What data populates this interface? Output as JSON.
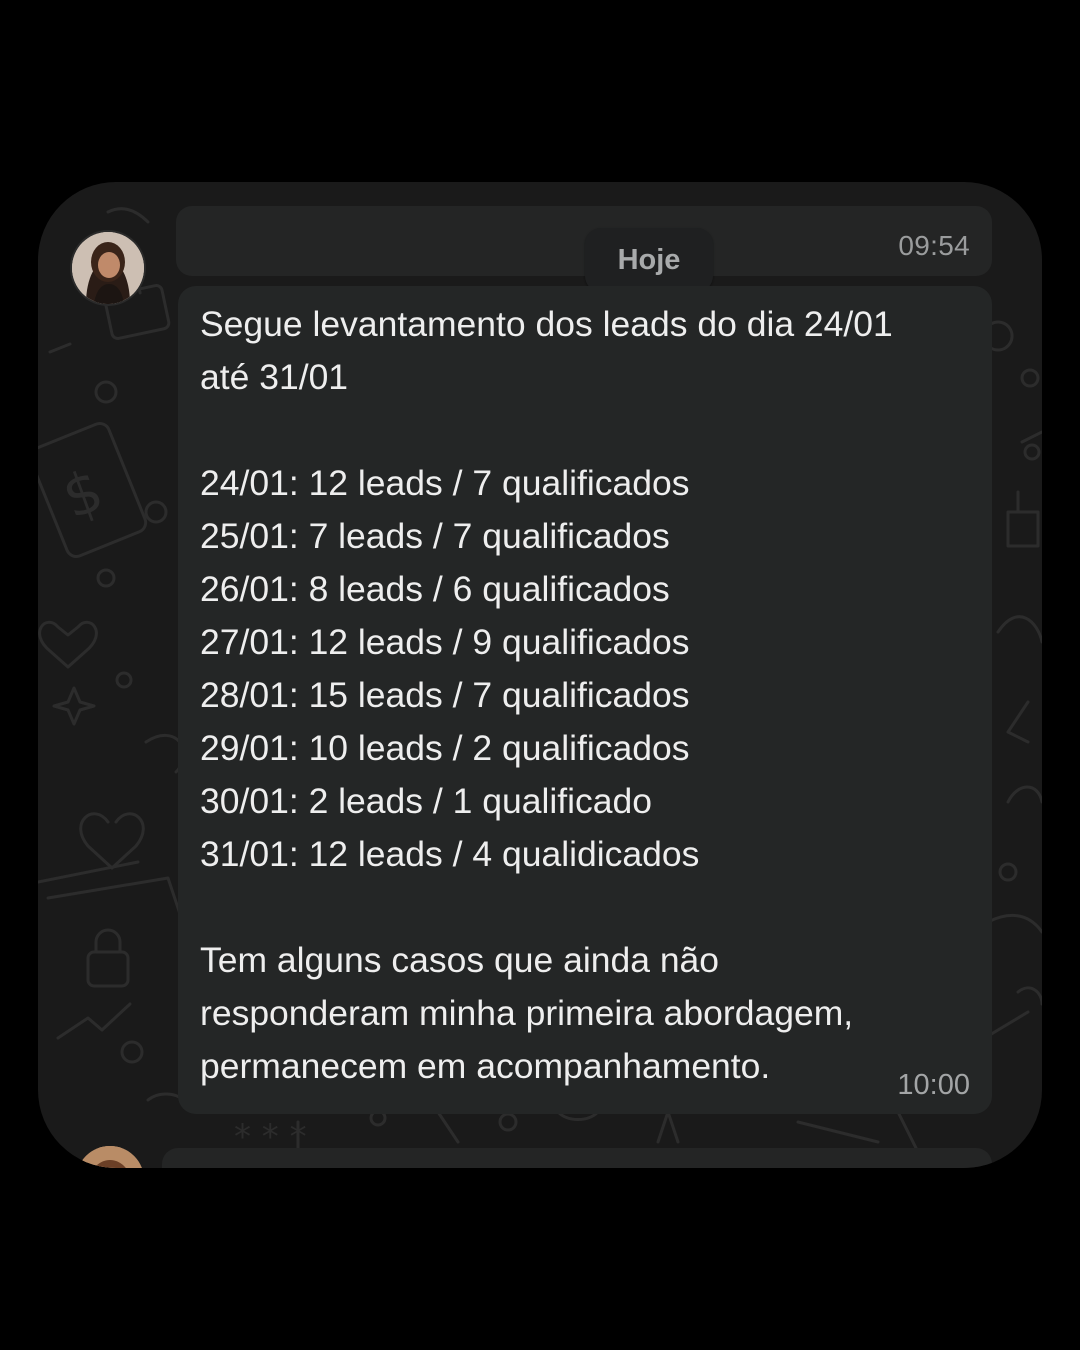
{
  "chat": {
    "date_separator": "Hoje",
    "previous_message": {
      "time": "09:54"
    },
    "message": {
      "intro_line1": "Segue levantamento dos leads do dia 24/01",
      "intro_line2": "até 31/01",
      "entries": [
        "24/01: 12 leads / 7 qualificados",
        "25/01: 7 leads / 7 qualificados",
        "26/01: 8 leads / 6 qualificados",
        "27/01: 12 leads / 9 qualificados",
        "28/01: 15 leads / 7 qualificados",
        "29/01: 10 leads / 2 qualificados",
        "30/01: 2 leads / 1 qualificado",
        "31/01: 12 leads / 4 qualidicados"
      ],
      "closing_line1": "Tem alguns casos que ainda não",
      "closing_line2": "responderam minha primeira abordagem,",
      "closing_line3": "permanecem em acompanhamento.",
      "time": "10:00"
    }
  },
  "theme": {
    "background": "#000000",
    "chat_background": "#1a1a1a",
    "bubble": "#242626",
    "text": "#eeeeee",
    "meta_text": "#a3a5a6"
  }
}
